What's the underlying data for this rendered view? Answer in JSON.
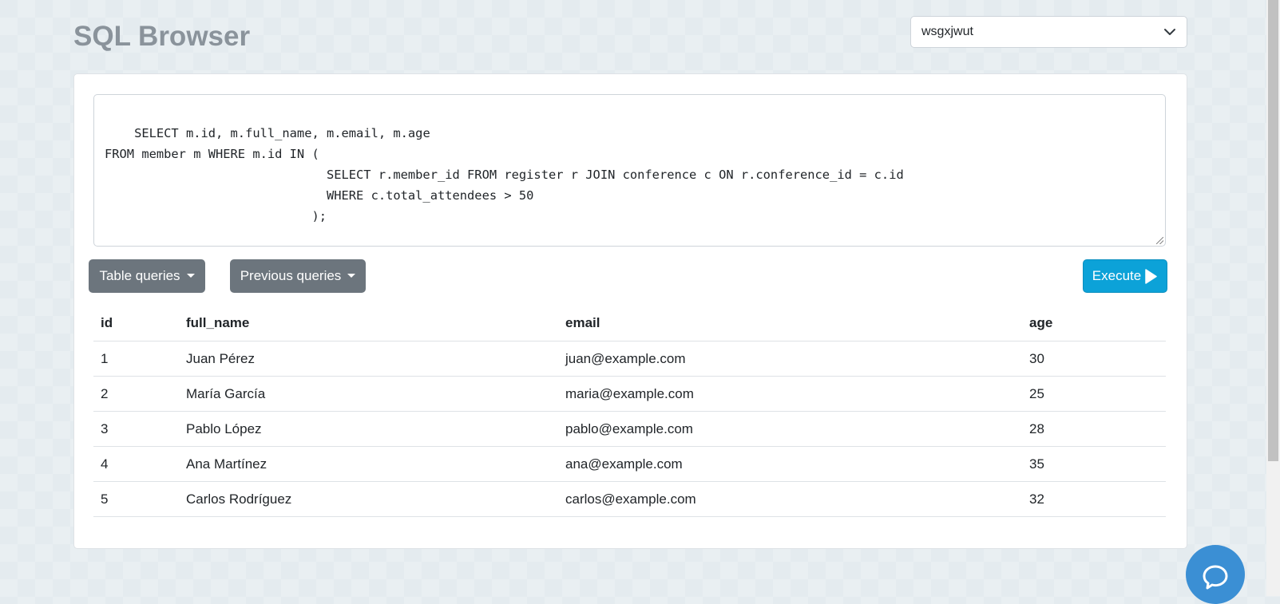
{
  "app": {
    "title": "SQL Browser"
  },
  "db_select": {
    "value": "wsgxjwut",
    "icon": "chevron-down-icon"
  },
  "editor": {
    "query": "SELECT m.id, m.full_name, m.email, m.age\nFROM member m WHERE m.id IN (\n                              SELECT r.member_id FROM register r JOIN conference c ON r.conference_id = c.id\n                              WHERE c.total_attendees > 50\n                            );"
  },
  "buttons": {
    "table_queries": "Table queries",
    "previous_queries": "Previous queries",
    "execute": "Execute"
  },
  "results": {
    "columns": [
      "id",
      "full_name",
      "email",
      "age"
    ],
    "rows": [
      [
        "1",
        "Juan Pérez",
        "juan@example.com",
        "30"
      ],
      [
        "2",
        "María García",
        "maria@example.com",
        "25"
      ],
      [
        "3",
        "Pablo López",
        "pablo@example.com",
        "28"
      ],
      [
        "4",
        "Ana Martínez",
        "ana@example.com",
        "35"
      ],
      [
        "5",
        "Carlos Rodríguez",
        "carlos@example.com",
        "32"
      ]
    ]
  },
  "colors": {
    "execute": "#0ca2d8",
    "secondary": "#6c757d",
    "chat": "#3b8fd4"
  }
}
